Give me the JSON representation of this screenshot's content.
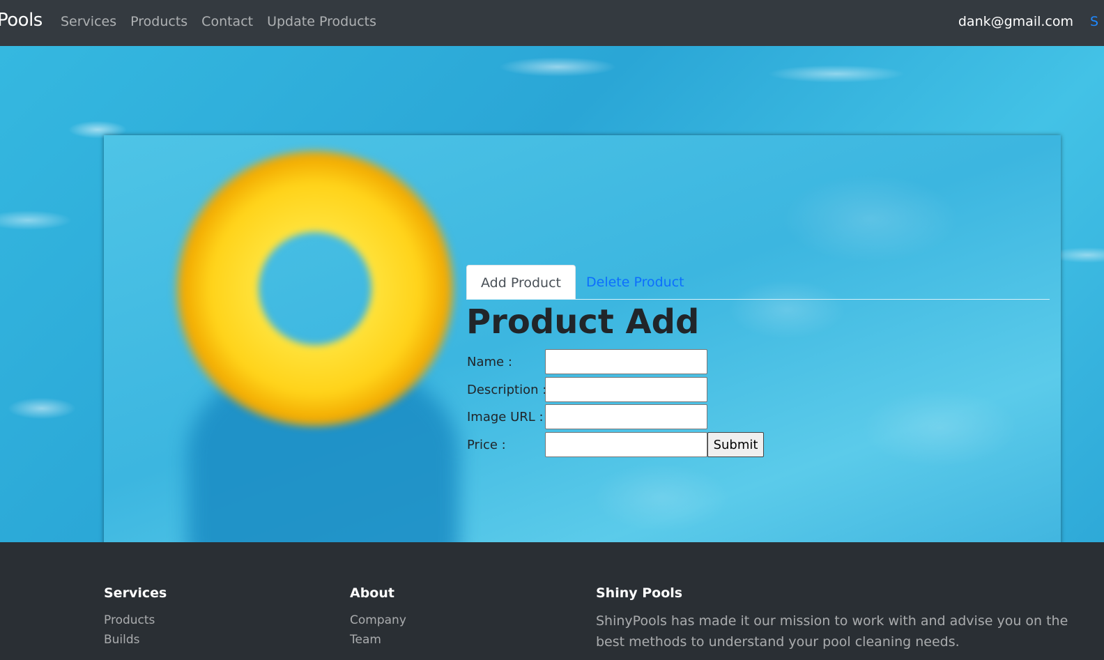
{
  "nav": {
    "brand": "Pools",
    "links": [
      "Services",
      "Products",
      "Contact",
      "Update Products"
    ],
    "user_email": "dank@gmail.com",
    "signout_partial": "S"
  },
  "tabs": {
    "add_label": "Add Product",
    "delete_label": "Delete Product"
  },
  "form": {
    "title": "Product Add",
    "name_label": "Name :",
    "description_label": "Description :",
    "image_url_label": "Image URL :",
    "price_label": "Price :",
    "name_value": "",
    "description_value": "",
    "image_url_value": "",
    "price_value": "",
    "submit_label": "Submit"
  },
  "footer": {
    "services": {
      "heading": "Services",
      "links": [
        "Products",
        "Builds"
      ]
    },
    "about": {
      "heading": "About",
      "links": [
        "Company",
        "Team"
      ]
    },
    "company": {
      "heading": "Shiny Pools",
      "text": "ShinyPools has made it our mission to work with and advise you on the best methods to understand your pool cleaning needs."
    }
  },
  "colors": {
    "navbar_bg": "#343a40",
    "footer_bg": "#2a2f34",
    "link_blue": "#0d6efd",
    "water_blue": "#3cb6e0",
    "float_yellow": "#ffd31a"
  }
}
